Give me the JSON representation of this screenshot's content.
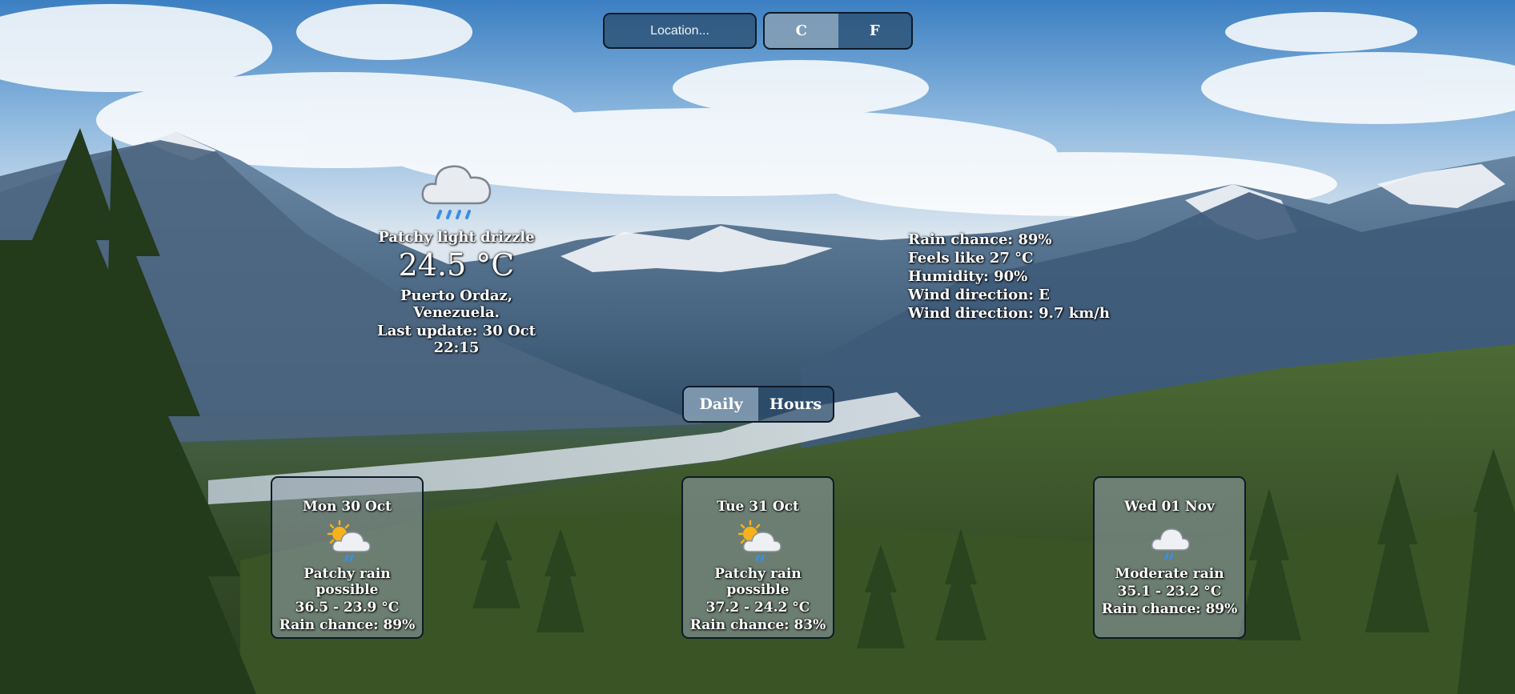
{
  "search": {
    "placeholder": "Location..."
  },
  "units": {
    "celsius_label": "C",
    "fahrenheit_label": "F"
  },
  "current": {
    "condition": "Patchy light drizzle",
    "temperature": "24.5 °C",
    "location": "Puerto Ordaz, Venezuela.",
    "last_update": "Last update: 30 Oct 22:15",
    "icon": "cloud-drizzle-icon"
  },
  "details": {
    "rain_chance": "Rain chance: 89%",
    "feels_like": "Feels like 27 °C",
    "humidity": "Humidity: 90%",
    "wind_direction": "Wind direction: E",
    "wind_speed": "Wind direction: 9.7 km/h"
  },
  "view": {
    "daily_label": "Daily",
    "hours_label": "Hours"
  },
  "forecast": [
    {
      "date": "Mon 30 Oct",
      "condition": "Patchy rain possible",
      "range": "36.5 - 23.9 °C",
      "rain": "Rain chance: 89%",
      "icon": "sun-cloud-rain-icon"
    },
    {
      "date": "Tue 31 Oct",
      "condition": "Patchy rain possible",
      "range": "37.2 - 24.2 °C",
      "rain": "Rain chance: 83%",
      "icon": "sun-cloud-rain-icon"
    },
    {
      "date": "Wed 01 Nov",
      "condition": "Moderate rain",
      "range": "35.1 - 23.2 °C",
      "rain": "Rain chance: 89%",
      "icon": "cloud-rain-icon"
    }
  ],
  "colors": {
    "control_border": "#0e1a28",
    "rain_blue": "#3a8ee6",
    "sun_yellow": "#f5b21b"
  }
}
